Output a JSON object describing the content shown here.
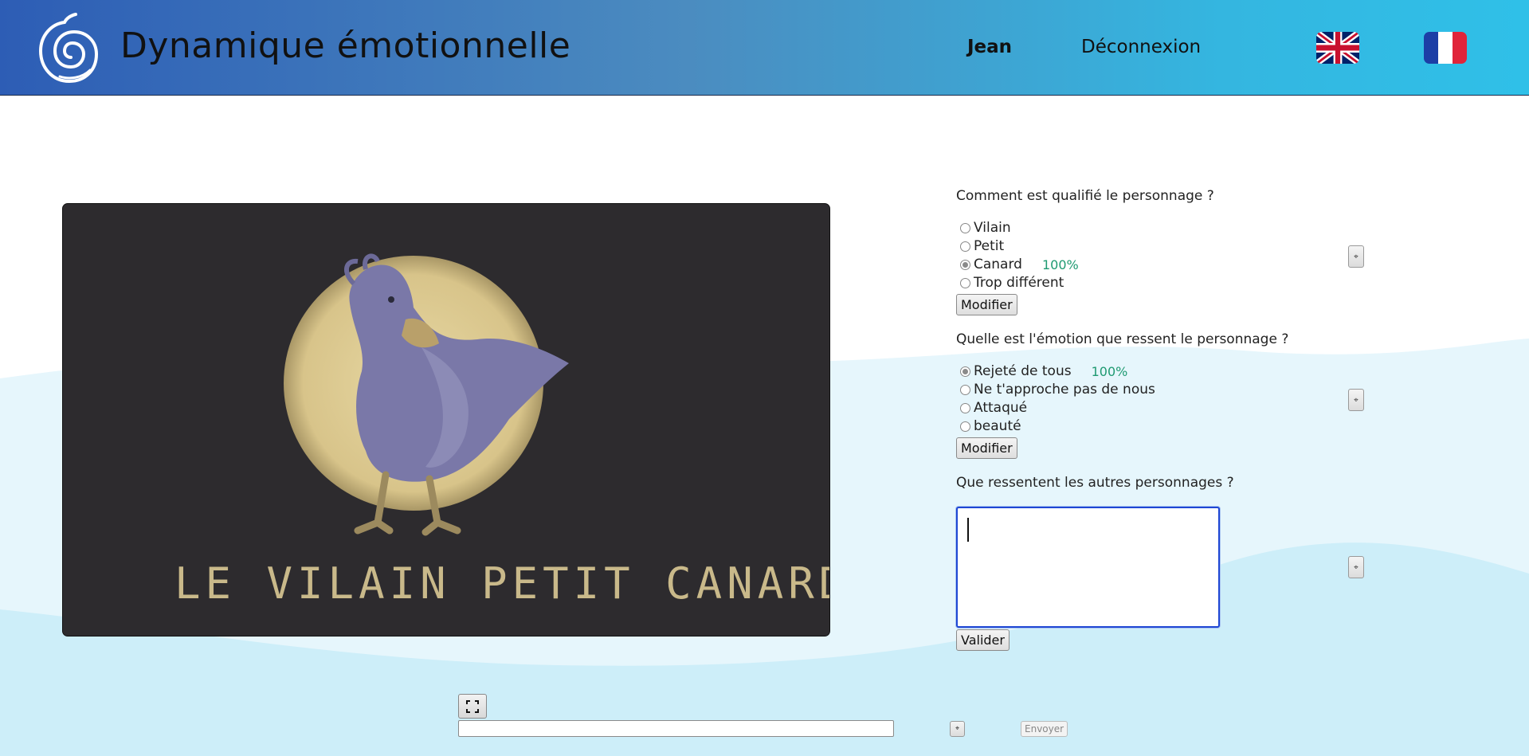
{
  "header": {
    "title": "Dynamique émotionnelle",
    "user": "Jean",
    "logout": "Déconnexion"
  },
  "image": {
    "caption": "LE VILAIN PETIT CANARD"
  },
  "questions": [
    {
      "label": "Comment est qualifié le personnage ?",
      "options": [
        {
          "label": "Vilain",
          "checked": false
        },
        {
          "label": "Petit",
          "checked": false
        },
        {
          "label": "Canard",
          "checked": true,
          "percent": "100%"
        },
        {
          "label": "Trop différent",
          "checked": false
        }
      ],
      "button": "Modifier"
    },
    {
      "label": "Quelle est l'émotion que ressent le personnage ?",
      "options": [
        {
          "label": "Rejeté de tous",
          "checked": true,
          "percent": "100%"
        },
        {
          "label": "Ne t'approche pas de nous",
          "checked": false
        },
        {
          "label": "Attaqué",
          "checked": false
        },
        {
          "label": "beauté",
          "checked": false
        }
      ],
      "button": "Modifier"
    },
    {
      "label": "Que ressentent les autres personnages ?",
      "input_value": "",
      "button": "Valider"
    }
  ],
  "side_button_glyph": "⌖",
  "bottom": {
    "input_value": "",
    "send": "Envoyer"
  },
  "colors": {
    "header_start": "#2d5db5",
    "header_end": "#2fc0e8",
    "percent": "#1f9a72",
    "focus": "#1f47d4"
  }
}
